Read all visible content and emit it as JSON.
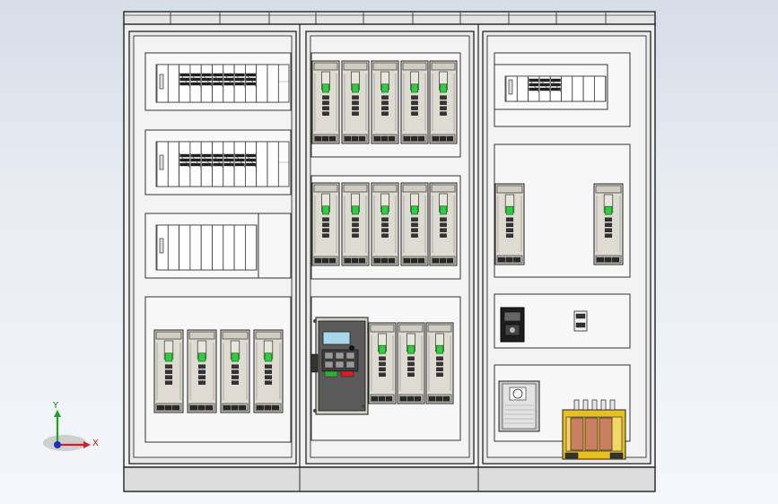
{
  "triad": {
    "x_label": "X",
    "y_label": "Y"
  },
  "colors": {
    "panel_face": "#e9e9e9",
    "drive_body": "#dedcd2",
    "drive_screen": "#2ecc40",
    "axis_x": "#d02020",
    "axis_y": "#20a020",
    "axis_z": "#2030c0",
    "transformer_frame": "#e8c020",
    "transformer_coil": "#c88060"
  },
  "cabinet": {
    "sections": [
      {
        "id": "left",
        "rows": [
          {
            "kind": "terminals",
            "blocks": 11,
            "dark": 7
          },
          {
            "kind": "terminals",
            "blocks": 11,
            "dark": 7
          },
          {
            "kind": "terminals",
            "blocks": 11,
            "dark": 0
          },
          {
            "kind": "drives",
            "count": 4
          }
        ]
      },
      {
        "id": "middle",
        "rows": [
          {
            "kind": "drives",
            "count": 5
          },
          {
            "kind": "drives",
            "count": 5
          },
          {
            "kind": "inverter_plus_drives",
            "count": 3
          }
        ]
      },
      {
        "id": "right",
        "rows": [
          {
            "kind": "terminals",
            "blocks": 9,
            "dark": 3
          },
          {
            "kind": "drives",
            "count": 2
          },
          {
            "kind": "breakers",
            "count": 2
          },
          {
            "kind": "vfd_and_transformer",
            "count": 2
          }
        ]
      }
    ]
  }
}
